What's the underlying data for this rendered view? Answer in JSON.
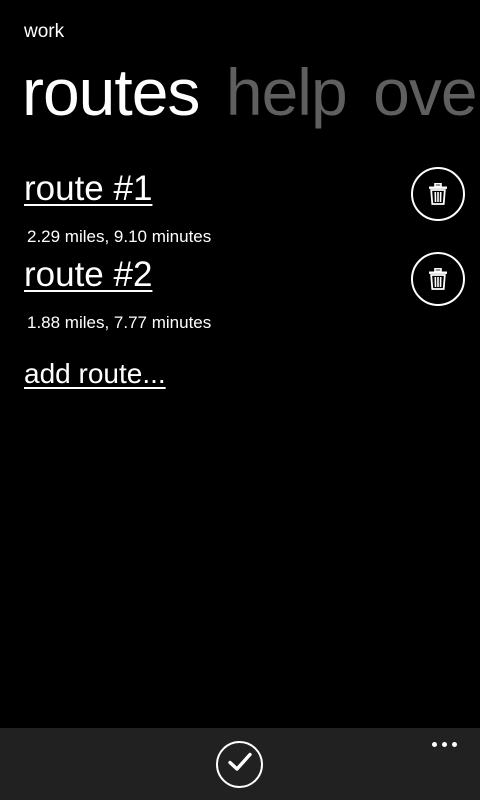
{
  "app": {
    "title": "work"
  },
  "pivot": {
    "headers": [
      {
        "label": "routes",
        "active": true
      },
      {
        "label": "help",
        "active": false
      },
      {
        "label": "ove",
        "active": false
      }
    ]
  },
  "routes": [
    {
      "name": "route #1",
      "stats": "2.29 miles, 9.10 minutes"
    },
    {
      "name": "route #2",
      "stats": "1.88 miles, 7.77 minutes"
    }
  ],
  "add_route": {
    "label": "add route..."
  },
  "icons": {
    "delete": "trash-icon",
    "confirm": "check-icon",
    "more": "ellipsis-icon"
  },
  "colors": {
    "background": "#000000",
    "foreground": "#ffffff",
    "inactive_pivot": "#5f5f5f",
    "app_bar": "#212121"
  }
}
